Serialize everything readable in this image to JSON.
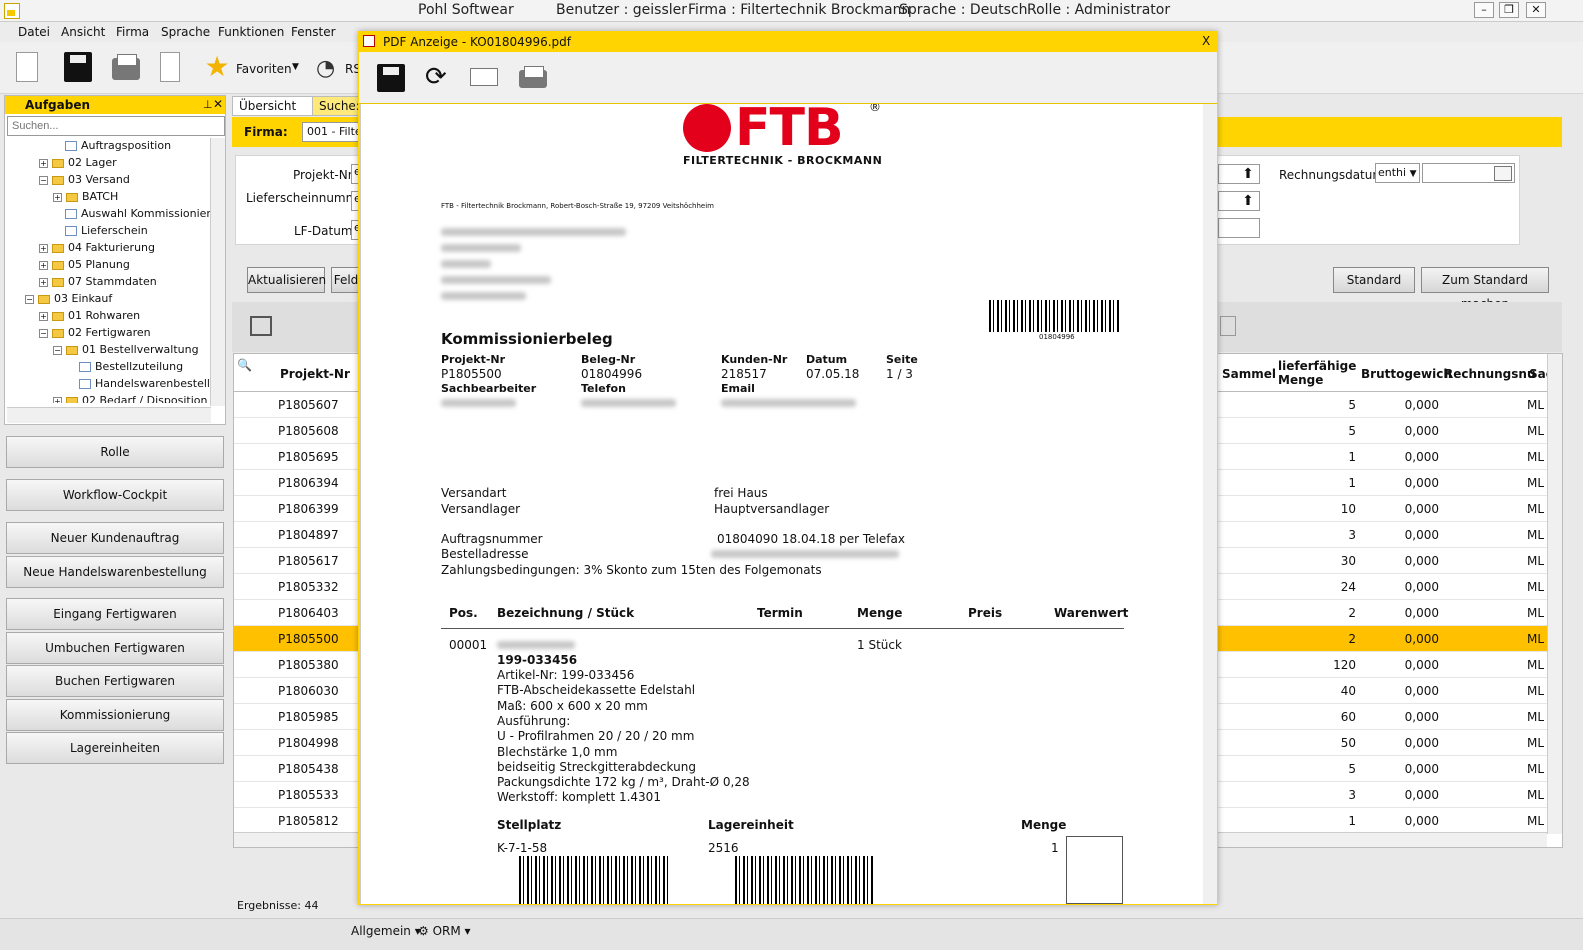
{
  "window": {
    "app": "Pohl Softwear",
    "user": "Benutzer :  geissler",
    "company": "Firma : Filtertechnik Brockmann",
    "language": "Sprache : Deutsch",
    "role": "Rolle : Administrator"
  },
  "menu": [
    "Datei",
    "Ansicht",
    "Firma",
    "Sprache",
    "Funktionen",
    "Fenster"
  ],
  "toolbar": {
    "favorites": "Favoriten",
    "rss": "RS"
  },
  "tasks": {
    "title": "Aufgaben",
    "search_placeholder": "Suchen...",
    "tree": [
      "Auftragsposition",
      "02 Lager",
      "03 Versand",
      "BATCH",
      "Auswahl Kommissionierb",
      "Lieferschein",
      "04 Fakturierung",
      "05 Planung",
      "07 Stammdaten",
      "03 Einkauf",
      "01 Rohwaren",
      "02 Fertigwaren",
      "01 Bestellverwaltung",
      "Bestellzuteilung",
      "Handelswarenbestellu",
      "02 Bedarf / Disposition"
    ]
  },
  "workflow_buttons": [
    "Rolle",
    "Workflow-Cockpit",
    "Neuer Kundenauftrag",
    "Neue Handelswarenbestellung",
    "Eingang Fertigwaren",
    "Umbuchen Fertigwaren",
    "Buchen Fertigwaren",
    "Kommissionierung",
    "Lagereinheiten"
  ],
  "main": {
    "tab1": "Übersicht",
    "tab2": "Suche: L",
    "firma_label": "Firma:",
    "firma_value": "001 - Filter",
    "filters": {
      "projekt_nr": "Projekt-Nr",
      "lieferscheinnummer": "Lieferscheinnumme",
      "lf_datum": "LF-Datum",
      "rechnungsdatum": "Rechnungsdatum",
      "rechnungsdatum_op": "enthi",
      "prefix": "e"
    },
    "buttons": {
      "aktualisieren": "Aktualisieren",
      "feld": "Feld",
      "standard": "Standard",
      "zum_standard": "Zum Standard machen"
    },
    "columns": {
      "projekt": "Projekt-Nr",
      "sammel": "Sammel",
      "lieferfaehig": "lieferfähige Menge",
      "brutto": "Bruttogewich",
      "rechnung": "Rechnungsnu",
      "sac": "Sac"
    },
    "rows": [
      {
        "p": "P1805607",
        "m": "5",
        "b": "0,000",
        "s": "ML"
      },
      {
        "p": "P1805608",
        "m": "5",
        "b": "0,000",
        "s": "ML"
      },
      {
        "p": "P1805695",
        "m": "1",
        "b": "0,000",
        "s": "ML"
      },
      {
        "p": "P1806394",
        "m": "1",
        "b": "0,000",
        "s": "ML"
      },
      {
        "p": "P1806399",
        "m": "10",
        "b": "0,000",
        "s": "ML"
      },
      {
        "p": "P1804897",
        "m": "3",
        "b": "0,000",
        "s": "ML"
      },
      {
        "p": "P1805617",
        "m": "30",
        "b": "0,000",
        "s": "ML"
      },
      {
        "p": "P1805332",
        "m": "24",
        "b": "0,000",
        "s": "ML"
      },
      {
        "p": "P1806403",
        "m": "2",
        "b": "0,000",
        "s": "ML"
      },
      {
        "p": "P1805500",
        "m": "2",
        "b": "0,000",
        "s": "ML"
      },
      {
        "p": "P1805380",
        "m": "120",
        "b": "0,000",
        "s": "ML"
      },
      {
        "p": "P1806030",
        "m": "40",
        "b": "0,000",
        "s": "ML"
      },
      {
        "p": "P1805985",
        "m": "60",
        "b": "0,000",
        "s": "ML"
      },
      {
        "p": "P1804998",
        "m": "50",
        "b": "0,000",
        "s": "ML"
      },
      {
        "p": "P1805438",
        "m": "5",
        "b": "0,000",
        "s": "ML"
      },
      {
        "p": "P1805533",
        "m": "3",
        "b": "0,000",
        "s": "ML"
      },
      {
        "p": "P1805812",
        "m": "1",
        "b": "0,000",
        "s": "ML"
      }
    ],
    "selected_row": "P1805500",
    "results": "Ergebnisse: 44"
  },
  "statusbar": {
    "allgemein": "Allgemein",
    "orm": "ORM"
  },
  "pdf": {
    "title": "PDF Anzeige - KO01804996.pdf",
    "close": "X",
    "logo_text": "FTB",
    "logo_reg": "®",
    "logo_sub": "FILTERTECHNIK - BROCKMANN",
    "sender": "FTB - Filtertechnik Brockmann, Robert-Bosch-Straße 19, 97209 Veitshöchheim",
    "barcode_num": "01804996",
    "doc_title": "Kommissionierbeleg",
    "labels": {
      "projekt": "Projekt-Nr",
      "beleg": "Beleg-Nr",
      "kunden": "Kunden-Nr",
      "datum": "Datum",
      "seite": "Seite",
      "sachbearbeiter": "Sachbearbeiter",
      "telefon": "Telefon",
      "email": "Email"
    },
    "values": {
      "projekt": "P1805500",
      "beleg": "01804996",
      "kunden": "218517",
      "datum": "07.05.18",
      "seite": "1 / 3"
    },
    "versandart_label": "Versandart",
    "versandart": "frei Haus",
    "versandlager_label": "Versandlager",
    "versandlager": "Hauptversandlager",
    "auftrag_label": "Auftragsnummer",
    "auftrag": "01804090 18.04.18 per Telefax",
    "bestell_label": "Bestelladresse",
    "zahlung": "Zahlungsbedingungen: 3% Skonto zum 15ten des Folgemonats",
    "cols": {
      "pos": "Pos.",
      "bez": "Bezeichnung / Stück",
      "termin": "Termin",
      "menge": "Menge",
      "preis": "Preis",
      "wert": "Warenwert"
    },
    "pos": "00001",
    "qty": "1 Stück",
    "item_lines": [
      "199-033456",
      "Artikel-Nr: 199-033456",
      "FTB-Abscheidekassette Edelstahl",
      "Maß: 600 x 600 x 20 mm",
      "Ausführung:",
      "U - Profilrahmen 20 / 20 / 20 mm",
      "Blechstärke 1,0 mm",
      "beidseitig Streckgitterabdeckung",
      "Packungsdichte 172 kg / m³, Draht-Ø 0,28",
      "Werkstoff: komplett 1.4301"
    ],
    "stellplatz_label": "Stellplatz",
    "stellplatz": "K-7-1-58",
    "lagereinheit_label": "Lagereinheit",
    "lagereinheit": "2516",
    "menge_label": "Menge",
    "menge": "1"
  }
}
